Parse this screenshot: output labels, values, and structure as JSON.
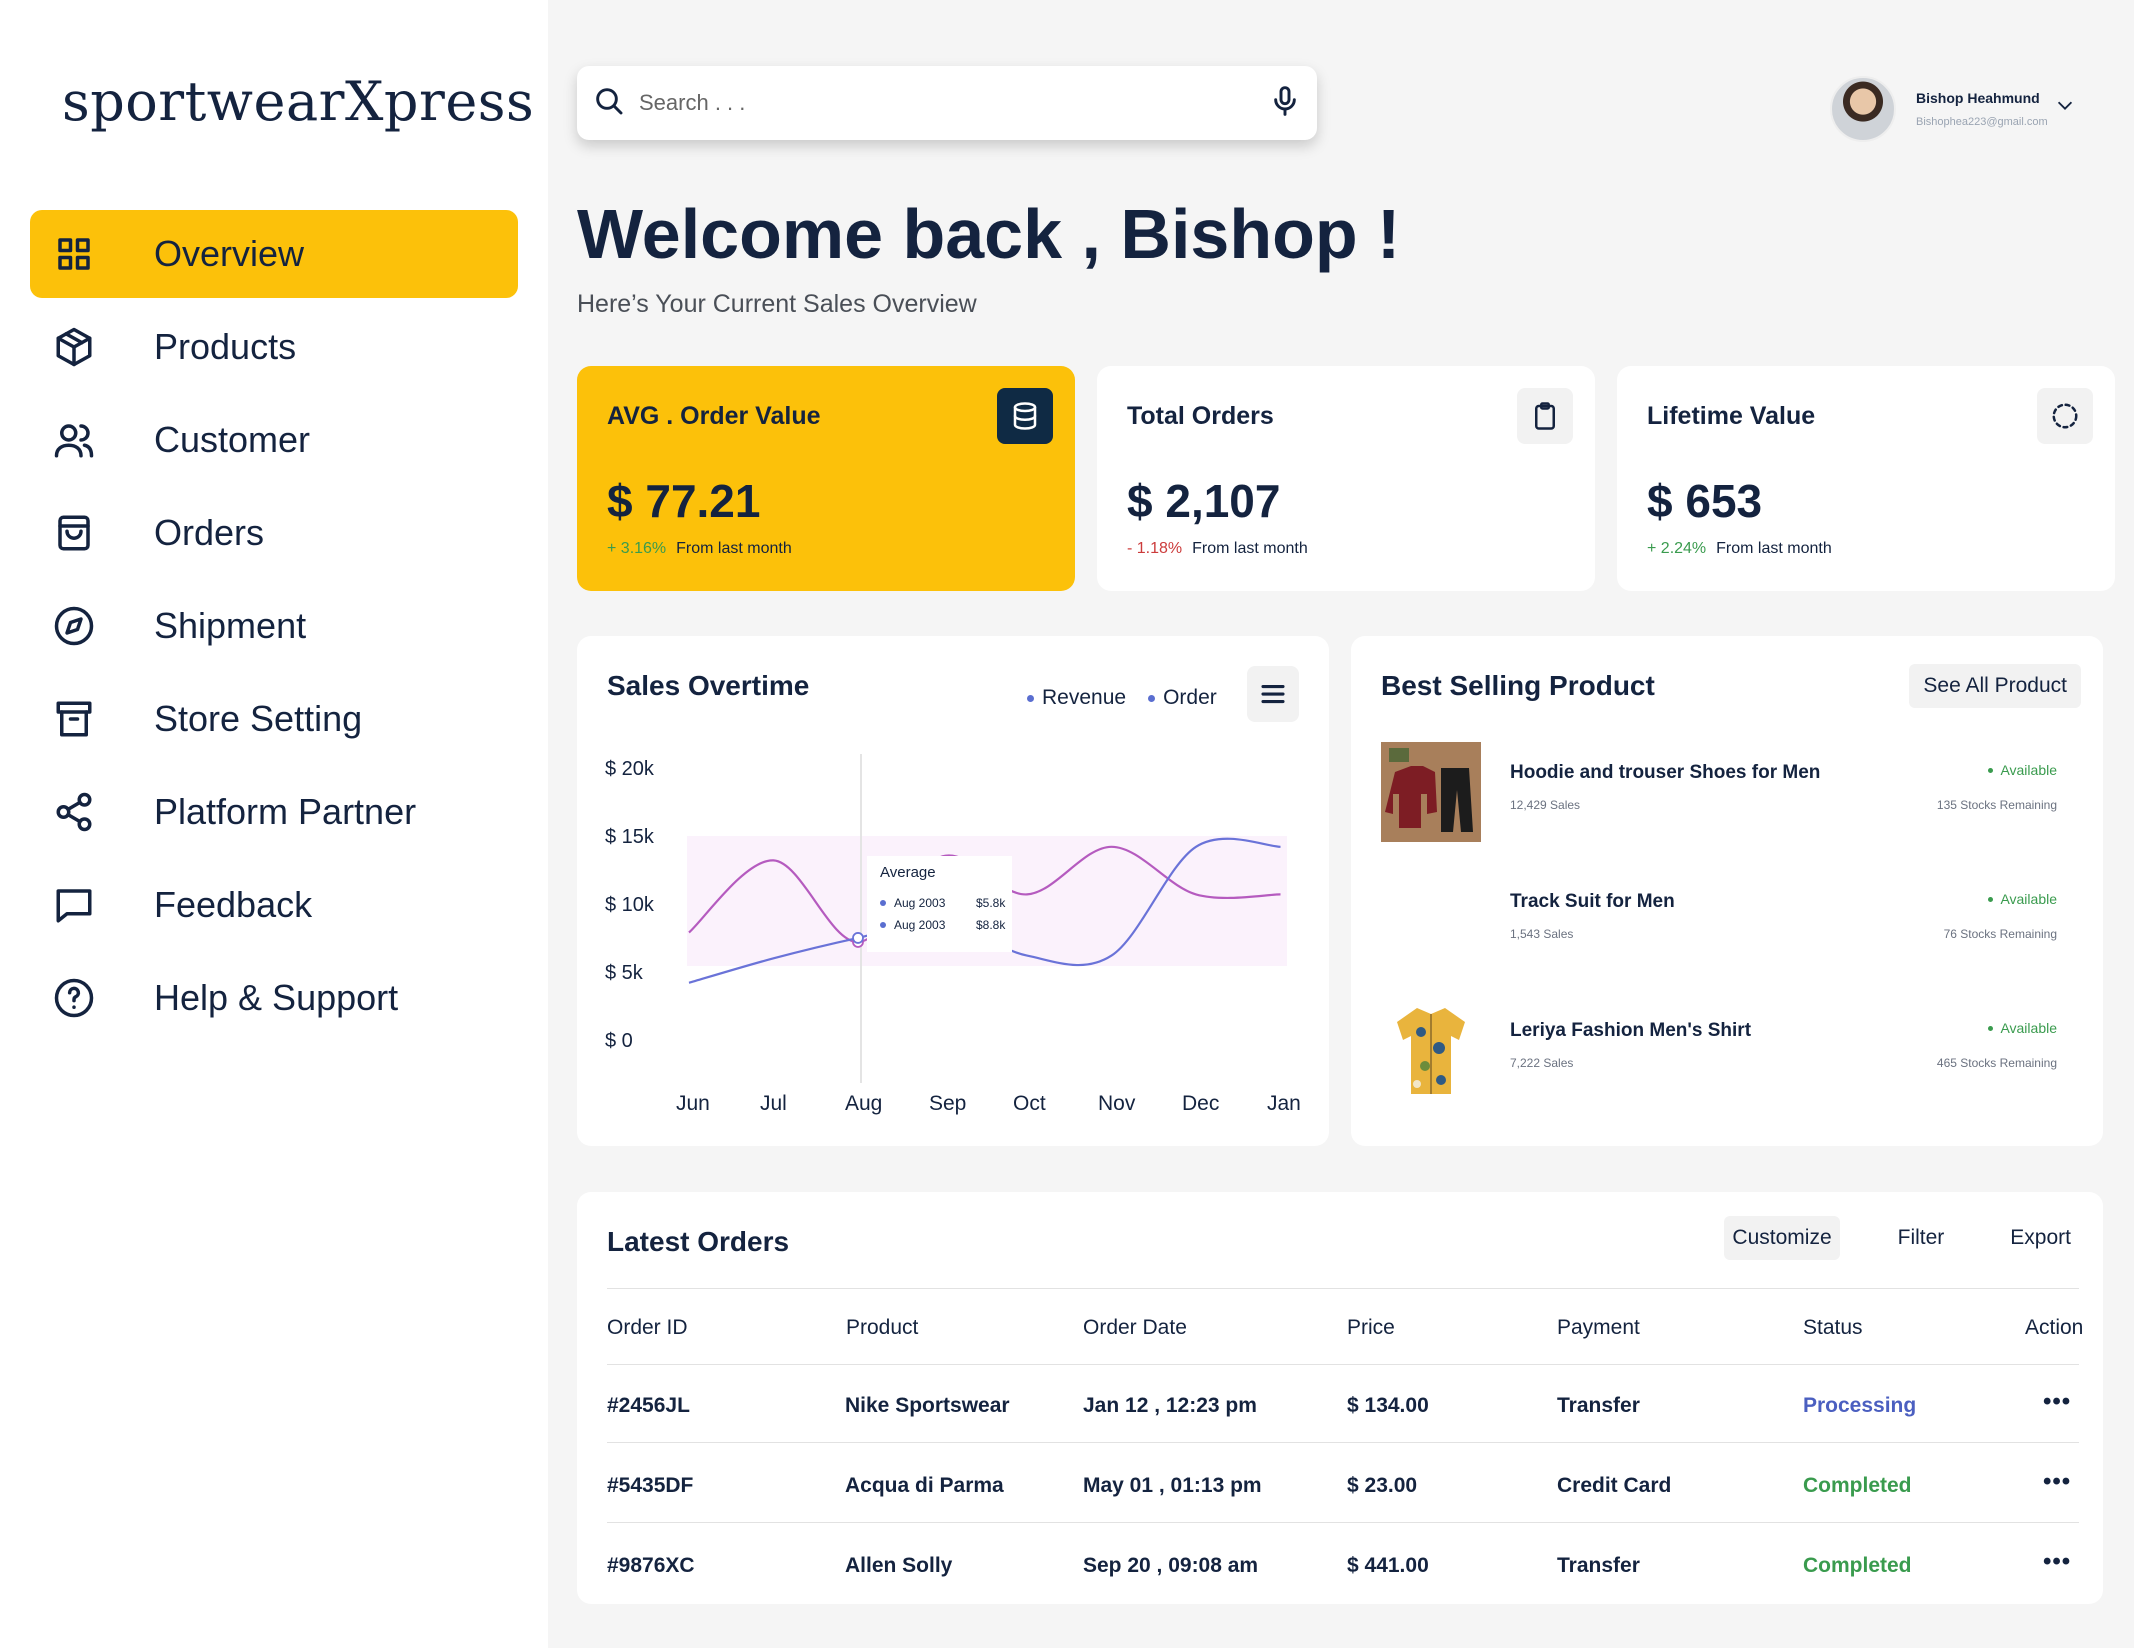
{
  "brand": {
    "name": "sportwearXpress"
  },
  "nav": {
    "items": [
      {
        "label": "Overview",
        "icon": "grid-icon",
        "active": true
      },
      {
        "label": "Products",
        "icon": "box-icon"
      },
      {
        "label": "Customer",
        "icon": "users-icon"
      },
      {
        "label": "Orders",
        "icon": "bag-icon"
      },
      {
        "label": "Shipment",
        "icon": "compass-icon"
      },
      {
        "label": "Store Setting",
        "icon": "archive-icon"
      },
      {
        "label": "Platform Partner",
        "icon": "share-icon"
      },
      {
        "label": "Feedback",
        "icon": "message-icon"
      },
      {
        "label": "Help & Support",
        "icon": "help-icon"
      }
    ]
  },
  "search": {
    "placeholder": "Search . . ."
  },
  "user": {
    "name": "Bishop Heahmund",
    "email": "Bishophea223@gmail.com"
  },
  "welcome": {
    "greeting": "Welcome back , ",
    "name": "Bishop !",
    "subtitle": "Here’s Your Current Sales Overview"
  },
  "stats": [
    {
      "title": "AVG . Order Value",
      "value": "$ 77.21",
      "change": "+ 3.16%",
      "change_dir": "up",
      "from": "From last month",
      "icon": "database-icon"
    },
    {
      "title": "Total Orders",
      "value": "$ 2,107",
      "change": "- 1.18%",
      "change_dir": "down",
      "from": "From last month",
      "icon": "clipboard-icon"
    },
    {
      "title": "Lifetime Value",
      "value": "$ 653",
      "change": "+ 2.24%",
      "change_dir": "up",
      "from": "From last month",
      "icon": "loader-icon"
    }
  ],
  "colors": {
    "accent": "#fcc10a",
    "navy": "#14233f",
    "revenue": "#b55bbf",
    "order": "#6a73d8",
    "success": "#3a9b4e",
    "danger": "#cc3b3b"
  },
  "sales_chart": {
    "title": "Sales Overtime",
    "legend": [
      "Revenue",
      "Order"
    ],
    "tooltip": {
      "title": "Average",
      "rows": [
        {
          "label": "Aug 2003",
          "value": "$5.8k"
        },
        {
          "label": "Aug 2003",
          "value": "$8.8k"
        }
      ]
    }
  },
  "chart_data": {
    "type": "line",
    "title": "Sales Overtime",
    "categories": [
      "Jun",
      "Jul",
      "Aug",
      "Sep",
      "Oct",
      "Nov",
      "Dec",
      "Jan"
    ],
    "y_tick_labels": [
      "$ 20k",
      "$ 15k",
      "$ 10k",
      "$ 5k",
      "$ 0"
    ],
    "ylim": [
      0,
      20000
    ],
    "series": [
      {
        "name": "Revenue",
        "values": [
          8200,
          13500,
          7500,
          13800,
          11000,
          14500,
          11000,
          11000
        ]
      },
      {
        "name": "Order",
        "values": [
          4500,
          6300,
          7800,
          9000,
          6500,
          6500,
          14500,
          14500
        ]
      }
    ]
  },
  "best_selling": {
    "title": "Best Selling Product",
    "see_all": "See All Product",
    "items": [
      {
        "name": "Hoodie and trouser Shoes for Men",
        "sales": "12,429 Sales",
        "status": "Available",
        "stock": "135 Stocks Remaining",
        "thumb": "hoodie-trouser-image"
      },
      {
        "name": "Track Suit for Men",
        "sales": "1,543 Sales",
        "status": "Available",
        "stock": "76 Stocks Remaining",
        "thumb": ""
      },
      {
        "name": "Leriya Fashion Men's Shirt",
        "sales": "7,222 Sales",
        "status": "Available",
        "stock": "465 Stocks Remaining",
        "thumb": "shirt-image"
      }
    ]
  },
  "latest_orders": {
    "title": "Latest Orders",
    "actions": [
      "Customize",
      "Filter",
      "Export"
    ],
    "columns": [
      "Order ID",
      "Product",
      "Order Date",
      "Price",
      "Payment",
      "Status",
      "Action"
    ],
    "rows": [
      {
        "id": "#2456JL",
        "product": "Nike Sportswear",
        "date": "Jan 12 , 12:23 pm",
        "price": "$ 134.00",
        "payment": "Transfer",
        "status": "Processing",
        "action": "•••"
      },
      {
        "id": "#5435DF",
        "product": "Acqua di Parma",
        "date": "May 01 , 01:13 pm",
        "price": "$ 23.00",
        "payment": "Credit Card",
        "status": "Completed",
        "action": "•••"
      },
      {
        "id": "#9876XC",
        "product": "Allen Solly",
        "date": "Sep 20 , 09:08 am",
        "price": "$ 441.00",
        "payment": "Transfer",
        "status": "Completed",
        "action": "•••"
      }
    ]
  }
}
